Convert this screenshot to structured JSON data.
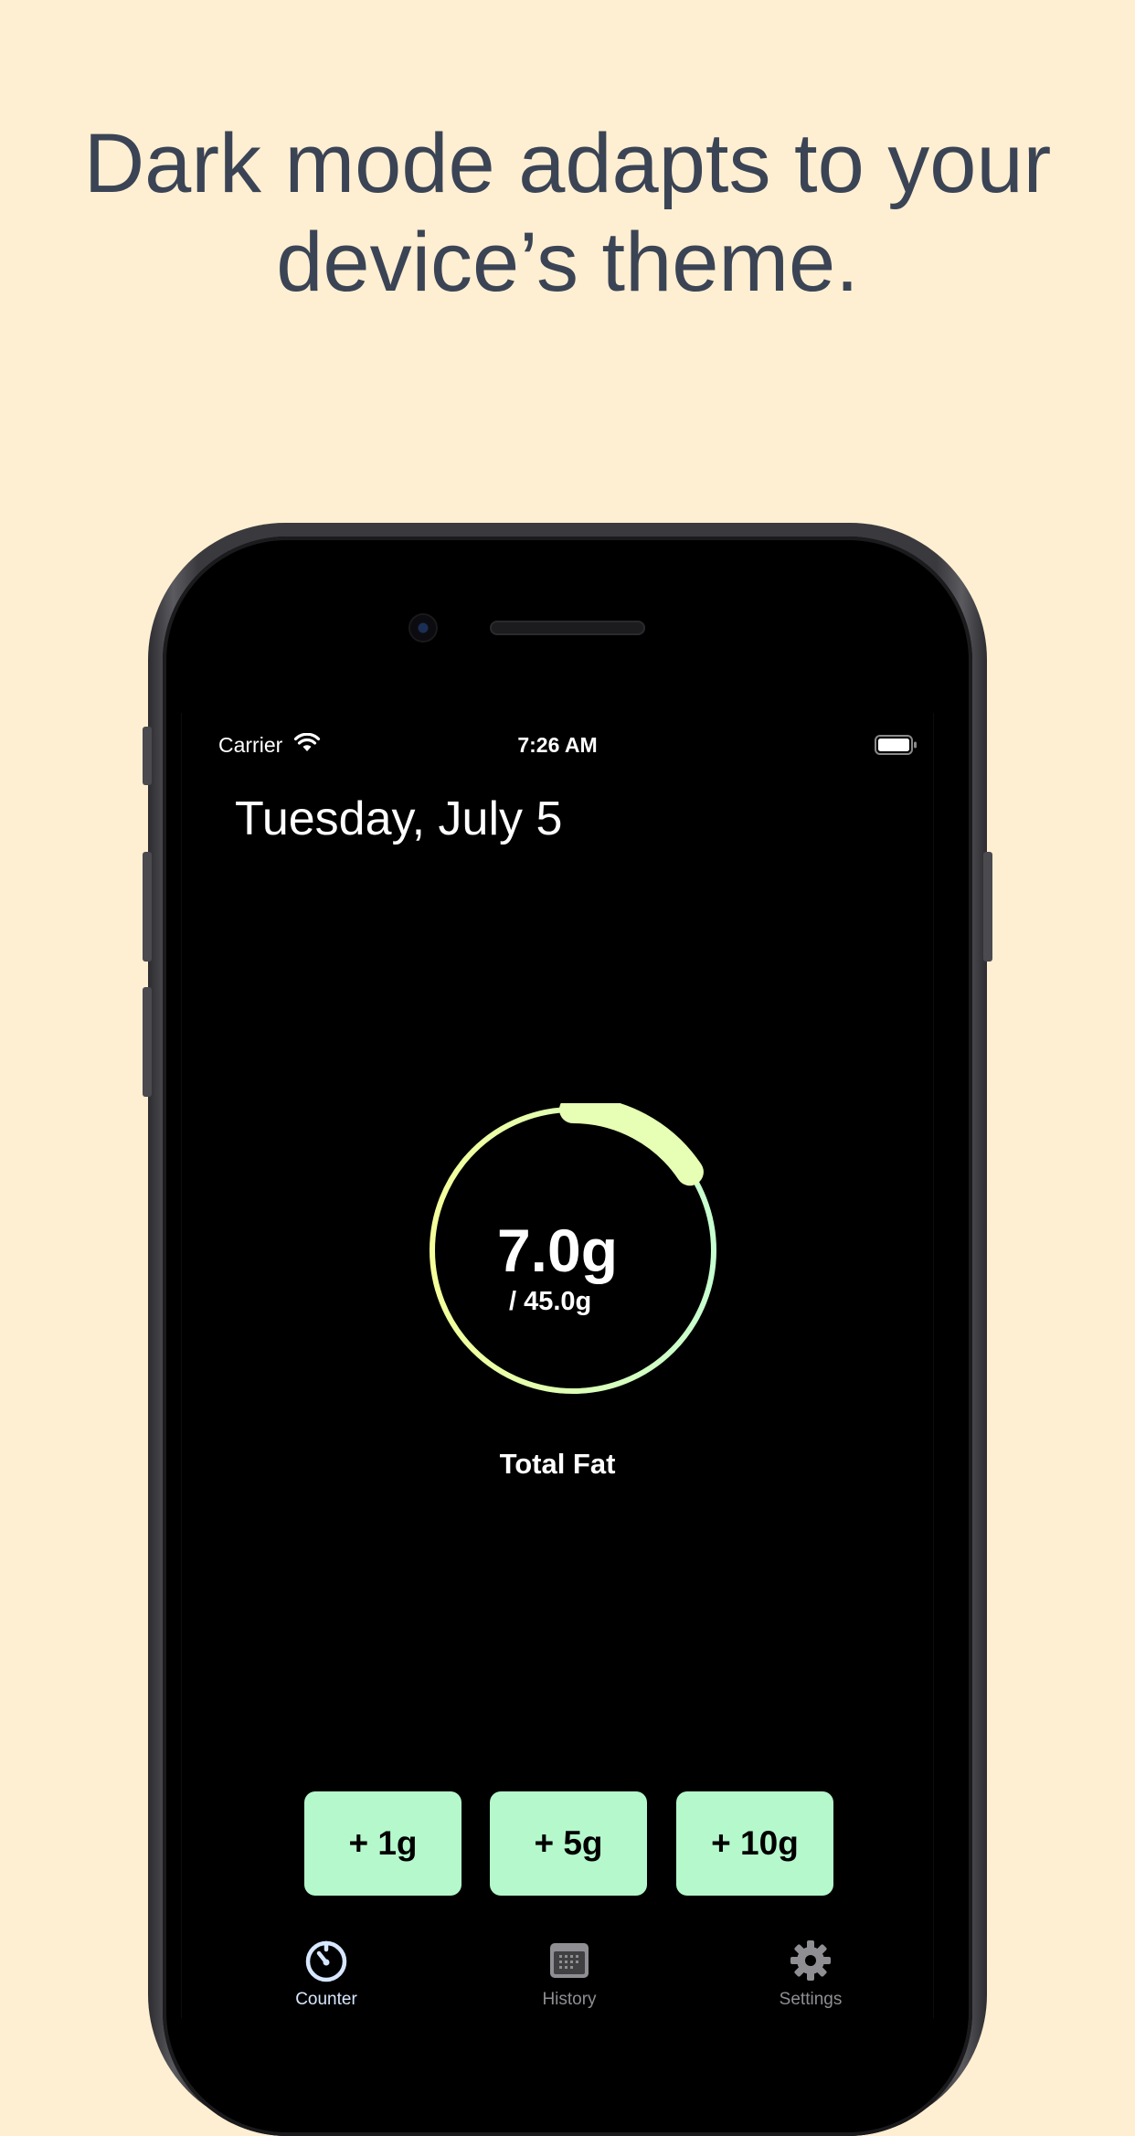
{
  "headline": "Dark mode adapts to your device’s theme.",
  "status_bar": {
    "carrier": "Carrier",
    "time": "7:26 AM"
  },
  "counter": {
    "date": "Tuesday, July 5",
    "value": "7.0g",
    "goal": "/ 45.0g",
    "nutrient": "Total Fat",
    "progress_fraction": 0.156
  },
  "add_buttons": [
    "+ 1g",
    "+ 5g",
    "+ 10g"
  ],
  "tabs": [
    {
      "label": "Counter",
      "icon": "timer-icon",
      "active": true
    },
    {
      "label": "History",
      "icon": "calendar-icon",
      "active": false
    },
    {
      "label": "Settings",
      "icon": "gear-icon",
      "active": false
    }
  ],
  "colors": {
    "background": "#FFEFD2",
    "headline": "#3B4455",
    "button": "#B5F8CC",
    "ring_start": "#F4FF9A",
    "ring_end": "#C6FFD0",
    "tab_active": "#D7E7FF",
    "tab_inactive": "#8E8E93"
  }
}
